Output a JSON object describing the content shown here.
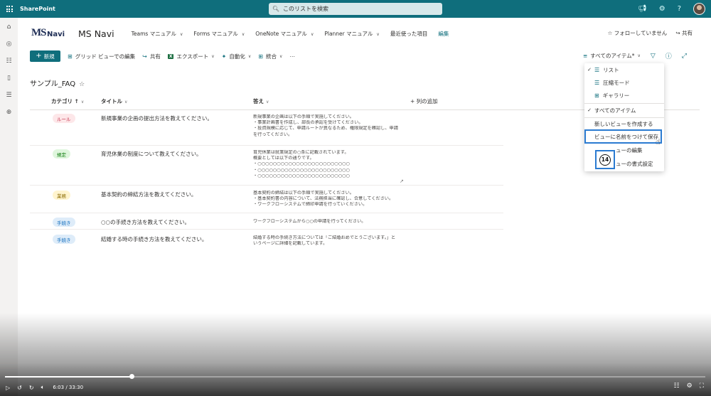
{
  "suite": {
    "app_name": "SharePoint",
    "search_placeholder": "このリストを検索",
    "icons": [
      "waffle-icon",
      "megaphone-icon",
      "settings-icon",
      "help-icon",
      "avatar"
    ]
  },
  "leftbar": {
    "icons": [
      "home-icon",
      "globe-icon",
      "news-icon",
      "page-icon",
      "list-icon",
      "add-circle-icon"
    ]
  },
  "site": {
    "logo_ms": "MS",
    "logo_navi": "Navi",
    "title": "MS Navi",
    "nav": [
      {
        "label": "Teams マニュアル"
      },
      {
        "label": "Forms マニュアル"
      },
      {
        "label": "OneNote マニュアル"
      },
      {
        "label": "Planner マニュアル"
      },
      {
        "label": "最近使った項目"
      }
    ],
    "edit_label": "編集",
    "follow_label": "フォローしていません",
    "share_label": "共有"
  },
  "commandbar": {
    "new_label": "新規",
    "grid_edit_label": "グリッド ビューでの編集",
    "share_label": "共有",
    "export_label": "エクスポート",
    "automate_label": "自動化",
    "integrate_label": "統合",
    "more_label": "⋯",
    "view_label": "すべてのアイテム*"
  },
  "list": {
    "title": "サンプル_FAQ",
    "columns": {
      "category": "カテゴリ ↑",
      "title": "タイトル",
      "answer": "答え",
      "add_column": "列の追加"
    },
    "rows": [
      {
        "tag": "ルール",
        "tag_bg": "#fde7e9",
        "tag_color": "#c4314b",
        "title": "新規事業の企画の提出方法を教えてください。",
        "answer": [
          "新規事業の企画は以下の手順で実施してください。",
          "・事業計画書を作成し、部長の承認を受けてください。",
          "・投資規模に応じて、申請ルートが異なるため、権限規定を確認し、申請",
          "を行ってください。"
        ]
      },
      {
        "tag": "規定",
        "tag_bg": "#dff6dd",
        "tag_color": "#107c10",
        "title": "育児休業の制度について教えてください。",
        "answer": [
          "育児休業は就業規定の○条に記載されています。",
          "概要としては以下の通りです。",
          "・○○○○○○○○○○○○○○○○○○○○○○○○",
          "・○○○○○○○○○○○○○○○○○○○○○○○○",
          "・○○○○○○○○○○○○○○○○○○○○○○○○"
        ]
      },
      {
        "tag": "業務",
        "tag_bg": "#fff4ce",
        "tag_color": "#8a6a00",
        "title": "基本契約の締結方法を教えてください。",
        "answer": [
          "基本契約の締結は以下の手順で実施してください。",
          "・基本契約書の内容について、法務担当に確認し、合意してください。",
          "・ワークフローシステムで締印申請を行っていください。"
        ]
      },
      {
        "tag": "手続き",
        "tag_bg": "#deecf9",
        "tag_color": "#0f6cbd",
        "title": "○○の手続き方法を教えてください。",
        "answer": [
          "ワークフローシステムから○○の申請を行ってください。"
        ]
      },
      {
        "tag": "手続き",
        "tag_bg": "#deecf9",
        "tag_color": "#0f6cbd",
        "title": "結婚する時の手続き方法を教えてください。",
        "answer": [
          "結婚する時の手続き方法については「ご結婚おめでとうございます。」と",
          "いうページに詳細を記載しています。"
        ]
      }
    ]
  },
  "view_menu": {
    "items": [
      {
        "label": "リスト",
        "checked": true
      },
      {
        "label": "圧縮モード",
        "checked": false
      },
      {
        "label": "ギャラリー",
        "checked": false
      },
      {
        "label": "すべてのアイテム",
        "checked": true
      },
      {
        "label": "新しいビューを作成する",
        "checked": false
      },
      {
        "label": "ビューに名前をつけて保存",
        "checked": false
      },
      {
        "label": "現在のビューの編集",
        "checked": false
      },
      {
        "label": "現在のビューの書式設定",
        "checked": false
      }
    ],
    "visible_edit_label": "ューの編集",
    "visible_format_label": "ューの書式設定",
    "step_badge": "14"
  },
  "video": {
    "time": "6:03 / 33:30",
    "progress": 0.181,
    "accent": "#ffffff"
  },
  "colors": {
    "suite_bar": "#0f6e7c",
    "accent": "#0f6e7c",
    "highlight": "#2b7bd1"
  }
}
